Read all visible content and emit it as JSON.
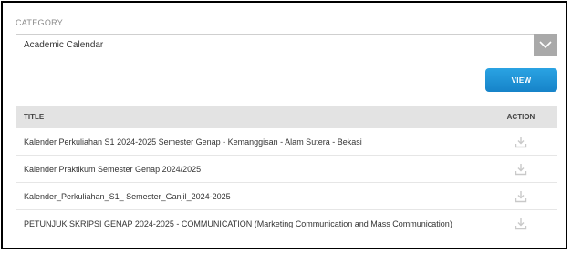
{
  "category": {
    "label": "CATEGORY",
    "selected": "Academic Calendar",
    "icon": "chevron-down-icon"
  },
  "view_button": {
    "label": "VIEW",
    "color": "#1a8fd6"
  },
  "table": {
    "headers": {
      "title": "TITLE",
      "action": "ACTION"
    },
    "rows": [
      {
        "title": "Kalender Perkuliahan S1 2024-2025 Semester Genap - Kemanggisan - Alam Sutera - Bekasi",
        "action_icon": "download-icon"
      },
      {
        "title": "Kalender Praktikum Semester Genap 2024/2025",
        "action_icon": "download-icon"
      },
      {
        "title": "Kalender_Perkuliahan_S1_ Semester_Ganjil_2024-2025",
        "action_icon": "download-icon"
      },
      {
        "title": "PETUNJUK SKRIPSI GENAP 2024-2025 - COMMUNICATION (Marketing Communication and Mass Communication)",
        "action_icon": "download-icon"
      }
    ]
  }
}
